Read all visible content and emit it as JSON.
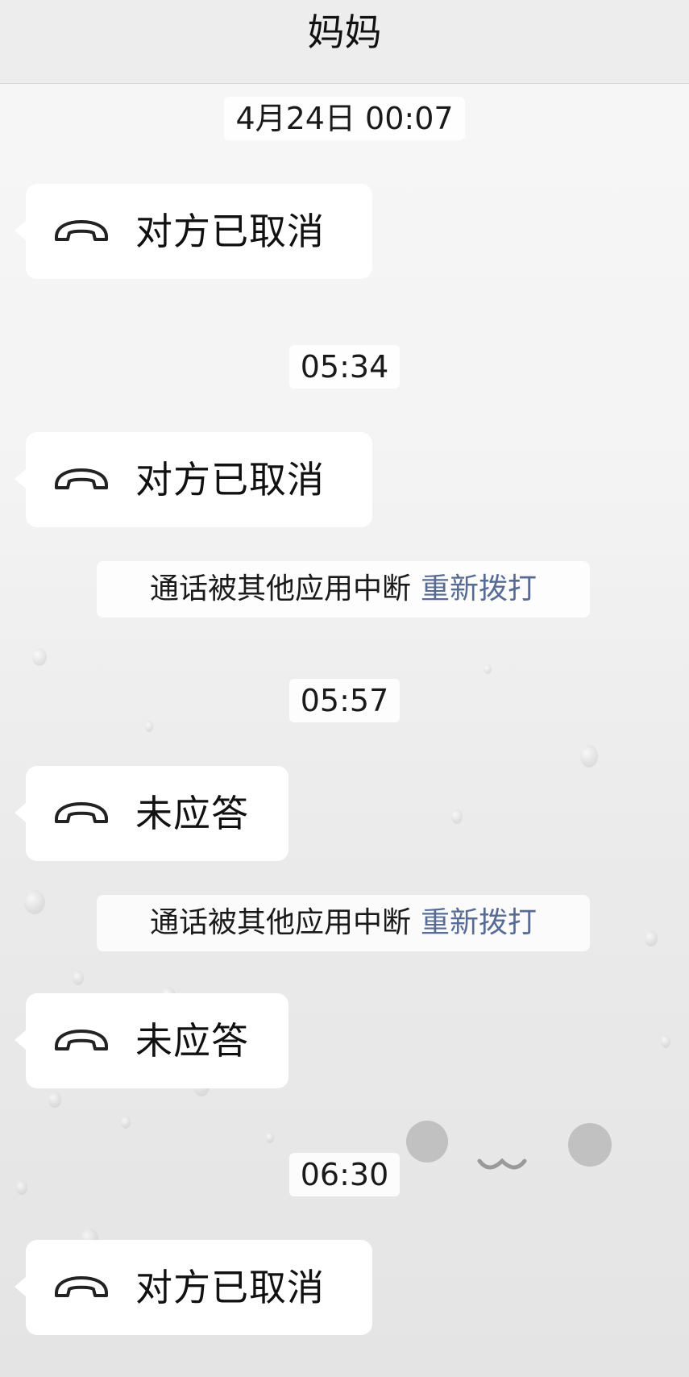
{
  "header": {
    "title": "妈妈"
  },
  "messages": {
    "ts1": "4月24日 00:07",
    "call1": "对方已取消",
    "ts2": "05:34",
    "call2": "对方已取消",
    "notice1": {
      "text": "通话被其他应用中断",
      "action": "重新拨打"
    },
    "ts3": "05:57",
    "call3": "未应答",
    "notice2": {
      "text": "通话被其他应用中断",
      "action": "重新拨打"
    },
    "call4": "未应答",
    "ts4": "06:30",
    "call5": "对方已取消"
  },
  "colors": {
    "link": "#576b95",
    "bubble": "#ffffff",
    "header_bg": "#ededed"
  },
  "icons": {
    "call": "phone-hangup-icon"
  }
}
